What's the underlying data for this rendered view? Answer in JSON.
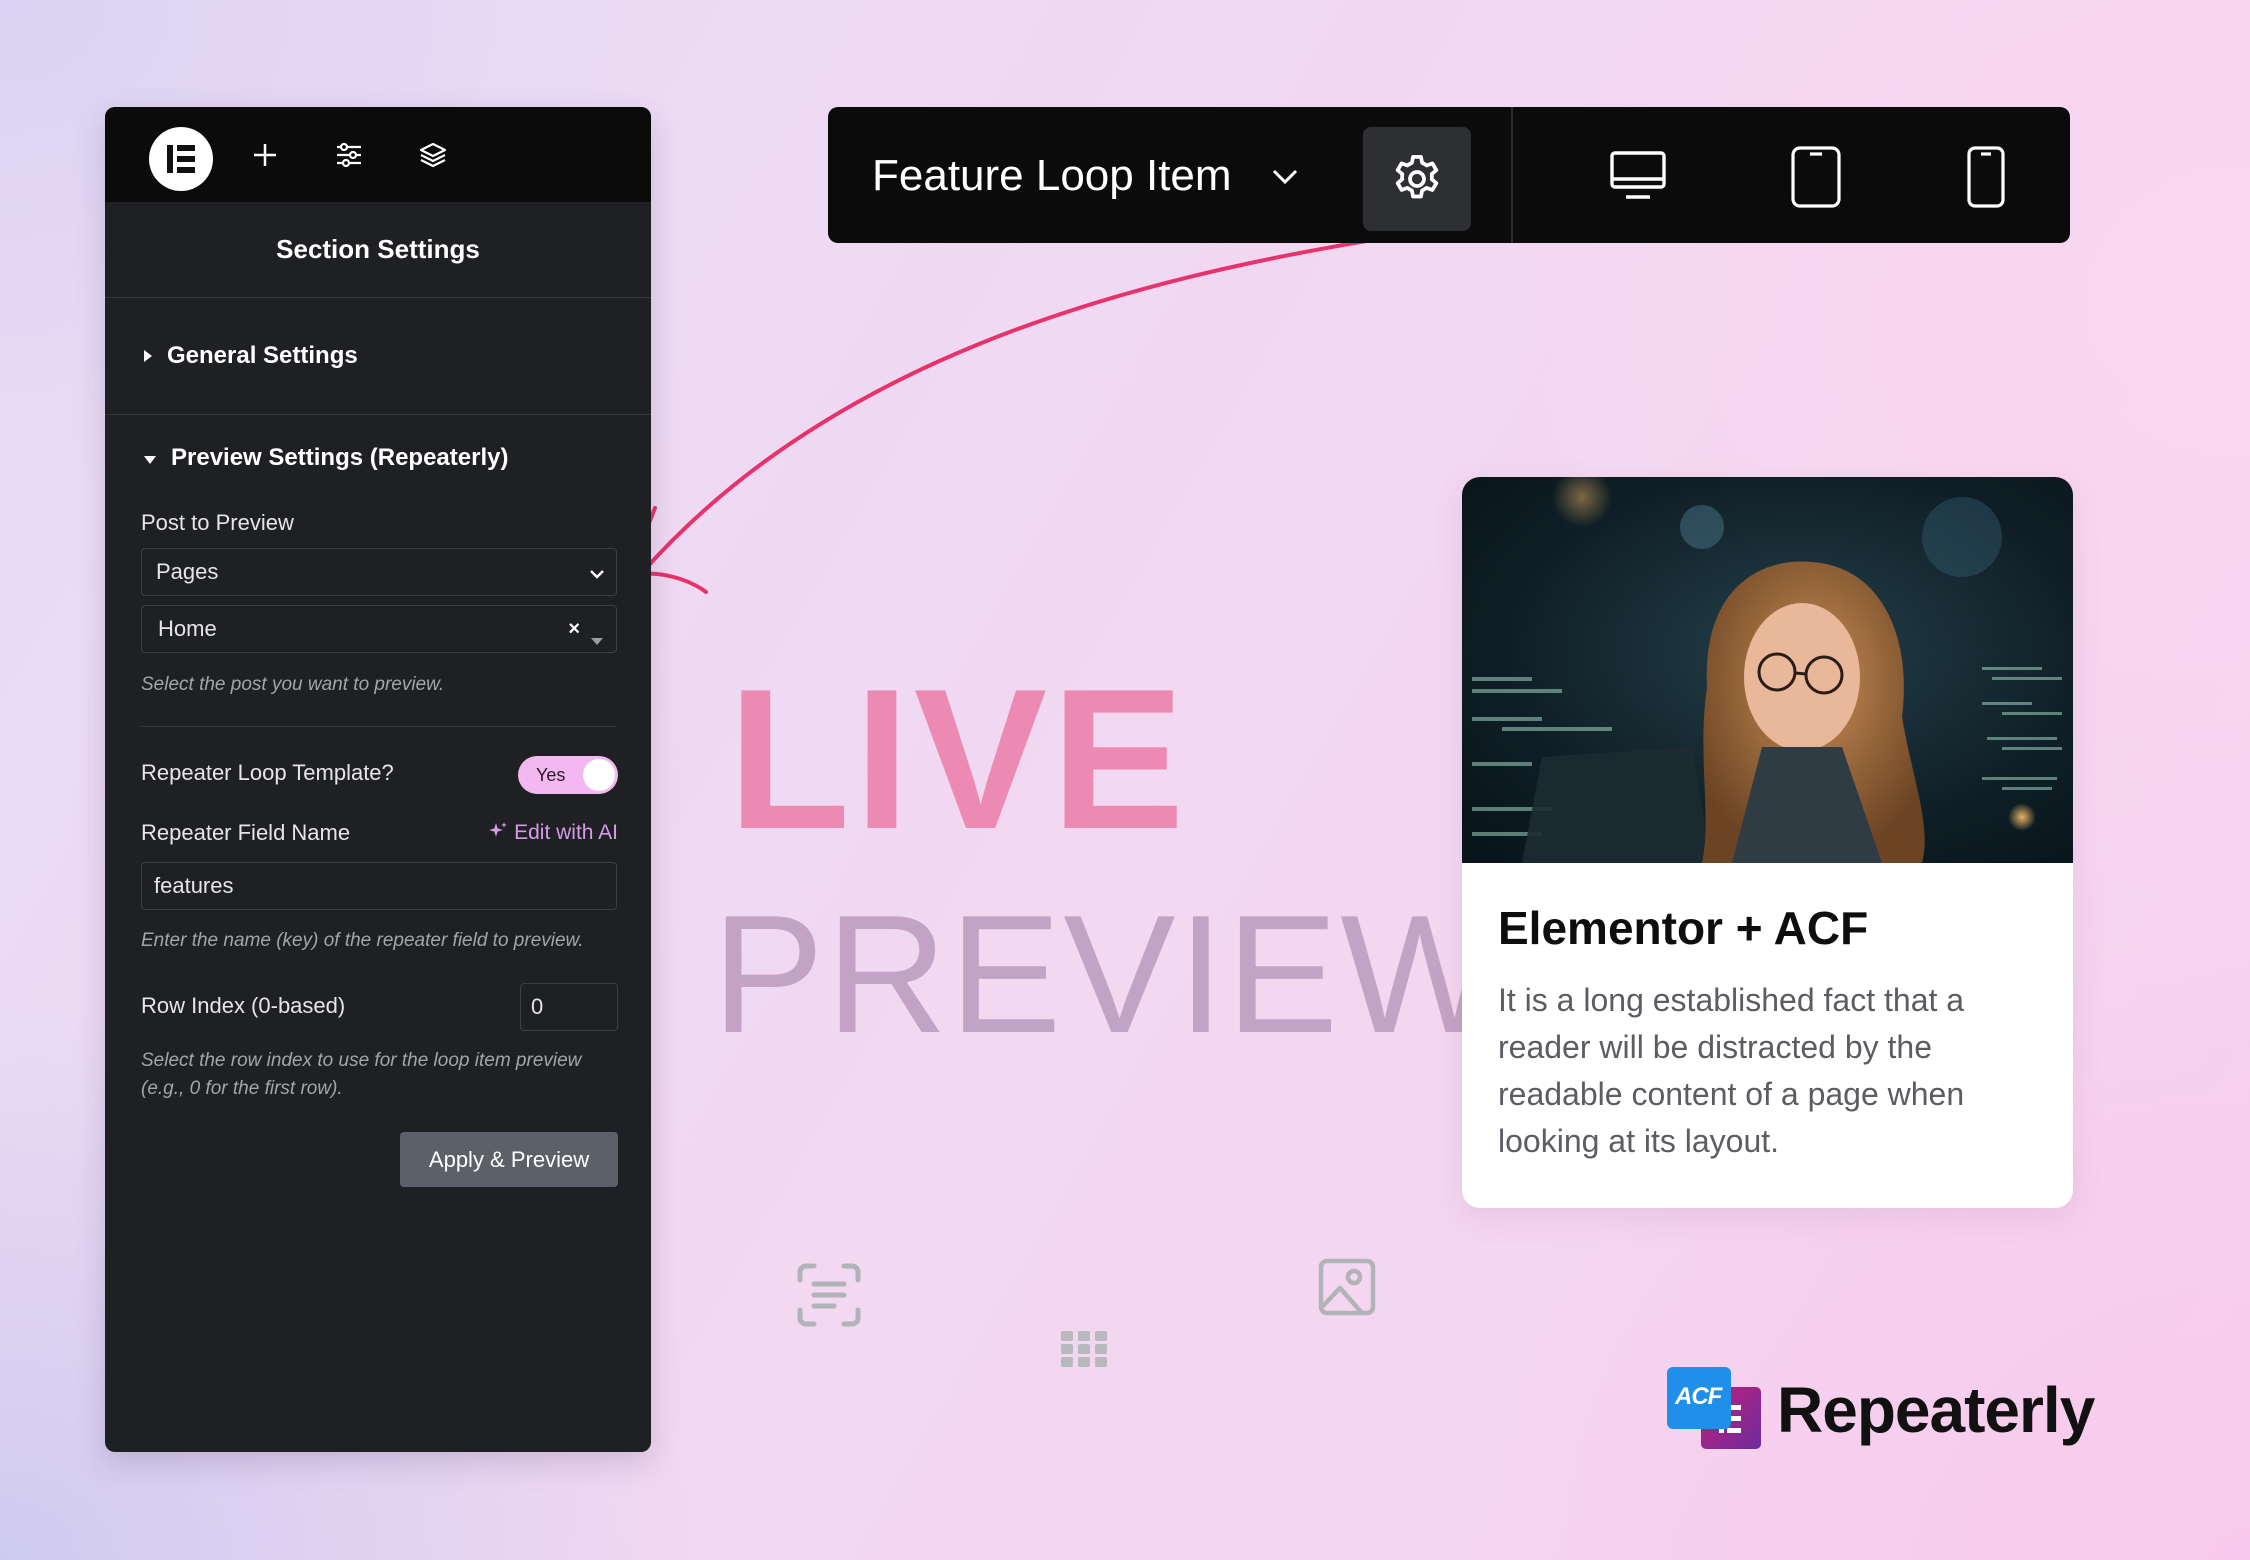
{
  "panel": {
    "title": "Section Settings",
    "general_settings": "General Settings",
    "preview_settings": "Preview Settings (Repeaterly)",
    "post_to_preview_label": "Post to Preview",
    "post_type_value": "Pages",
    "post_value": "Home",
    "post_help": "Select the post you want to preview.",
    "repeater_loop_label": "Repeater Loop Template?",
    "repeater_loop_toggle": "Yes",
    "repeater_field_label": "Repeater Field Name",
    "edit_with_ai": "Edit with AI",
    "repeater_field_value": "features",
    "repeater_field_help": "Enter the name (key) of the repeater field to preview.",
    "row_index_label": "Row Index (0-based)",
    "row_index_value": "0",
    "row_index_help_1": "Select the row index to use for the loop item preview",
    "row_index_help_2": "(e.g., 0 for the first row).",
    "apply_button": "Apply & Preview"
  },
  "toolbar": {
    "title": "Feature Loop Item"
  },
  "hero": {
    "live": "LIVE",
    "preview": "PREVIEW"
  },
  "card": {
    "title": "Elementor + ACF",
    "body": "It is a long established fact that a reader will be distracted by the readable content of a page when looking at its layout."
  },
  "brand": {
    "name": "Repeaterly",
    "badge_text": "ACF"
  },
  "colors": {
    "accent_pink": "#e8326a",
    "live_pink": "#ec8ab4",
    "toggle_pink": "#f2b8ef"
  }
}
